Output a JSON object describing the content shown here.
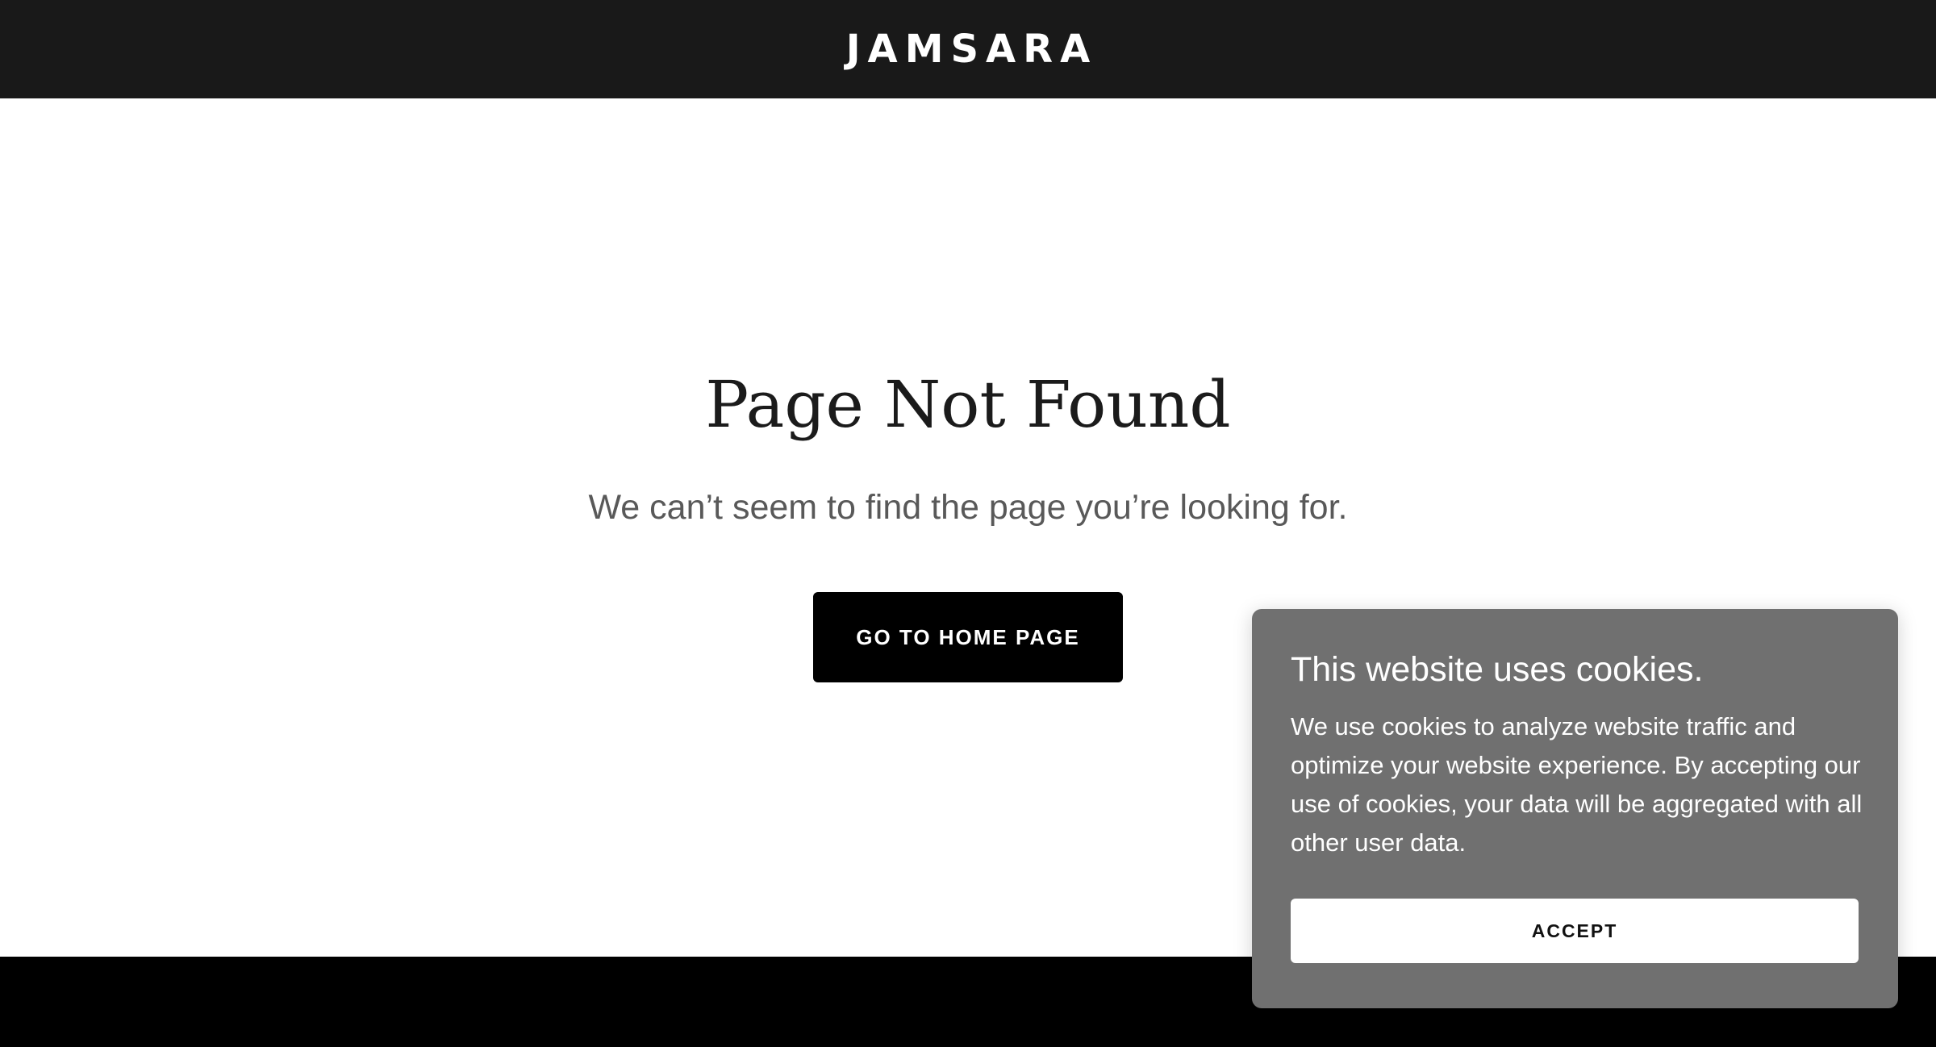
{
  "header": {
    "logo_text": "JAMSARA"
  },
  "main": {
    "title": "Page Not Found",
    "subtitle": "We can’t seem to find the page you’re looking for.",
    "home_button_label": "GO TO HOME PAGE"
  },
  "cookie_banner": {
    "title": "This website uses cookies.",
    "text": "We use cookies to analyze website traffic and optimize your website experience. By accepting our use of cookies, your data will be aggregated with all other user data.",
    "accept_label": "ACCEPT"
  },
  "colors": {
    "header_bg": "#191919",
    "footer_bg": "#000000",
    "button_bg": "#000000",
    "cookie_bg": "#707070",
    "subtitle_text": "#595959"
  }
}
